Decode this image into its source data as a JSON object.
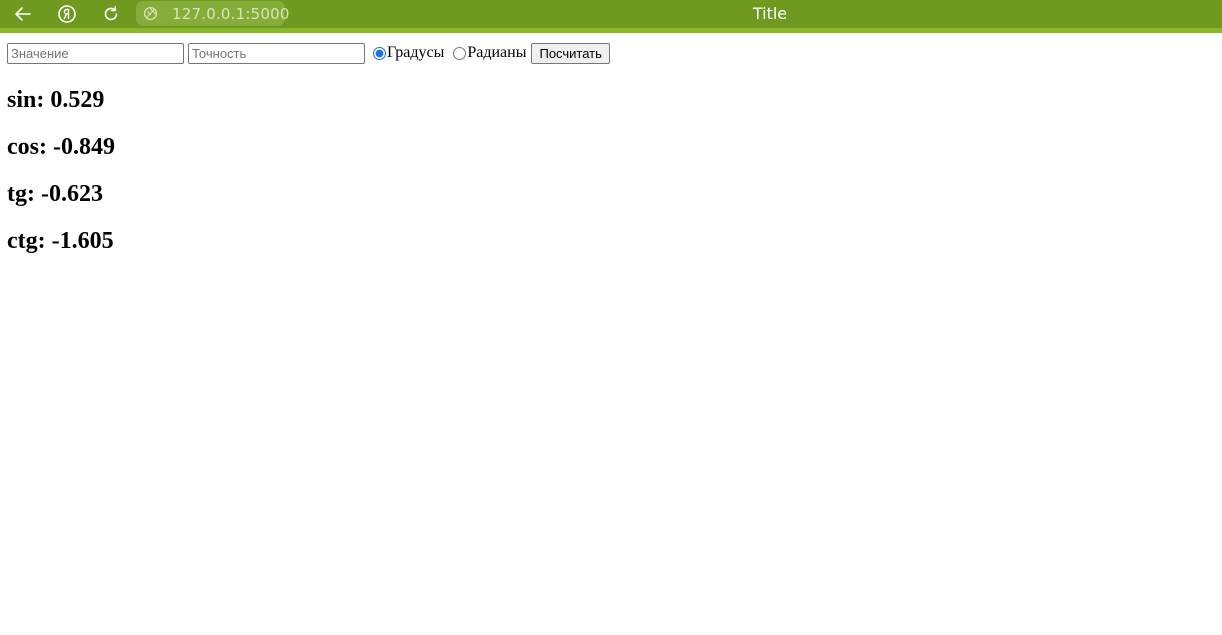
{
  "browser": {
    "url": "127.0.0.1:5000",
    "tab_title": "Title",
    "bar_color": "#6f991f"
  },
  "form": {
    "value_placeholder": "Значение",
    "value": "",
    "precision_placeholder": "Точность",
    "precision": "",
    "units": {
      "options": [
        "Градусы",
        "Радианы"
      ],
      "selected": "Градусы"
    },
    "submit_label": "Посчитать"
  },
  "results": {
    "sin": "sin: 0.529",
    "cos": "cos: -0.849",
    "tg": "tg: -0.623",
    "ctg": "ctg: -1.605"
  }
}
